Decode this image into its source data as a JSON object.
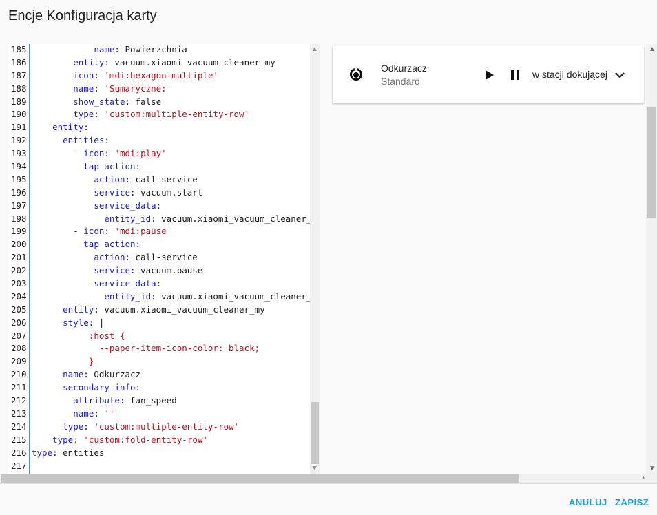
{
  "dialog": {
    "title": "Encje Konfiguracja karty",
    "cancel_label": "ANULUJ",
    "save_label": "ZAPISZ"
  },
  "editor": {
    "lines": [
      {
        "n": "185",
        "parts": [
          [
            "",
            "            "
          ],
          [
            "k",
            "name"
          ],
          [
            "v",
            ": Powierzchnia"
          ]
        ]
      },
      {
        "n": "186",
        "parts": [
          [
            "",
            "        "
          ],
          [
            "k",
            "entity"
          ],
          [
            "v",
            ": vacuum.xiaomi_vacuum_cleaner_my"
          ]
        ]
      },
      {
        "n": "187",
        "parts": [
          [
            "",
            "        "
          ],
          [
            "k",
            "icon"
          ],
          [
            "v",
            ": "
          ],
          [
            "s",
            "'mdi:hexagon-multiple'"
          ]
        ]
      },
      {
        "n": "188",
        "parts": [
          [
            "",
            "        "
          ],
          [
            "k",
            "name"
          ],
          [
            "v",
            ": "
          ],
          [
            "s",
            "'Sumaryczne:'"
          ]
        ]
      },
      {
        "n": "189",
        "parts": [
          [
            "",
            "        "
          ],
          [
            "k",
            "show_state"
          ],
          [
            "v",
            ": false"
          ]
        ]
      },
      {
        "n": "190",
        "parts": [
          [
            "",
            "        "
          ],
          [
            "k",
            "type"
          ],
          [
            "v",
            ": "
          ],
          [
            "s",
            "'custom:multiple-entity-row'"
          ]
        ]
      },
      {
        "n": "191",
        "parts": [
          [
            "",
            "    "
          ],
          [
            "k",
            "entity"
          ],
          [
            "v",
            ":"
          ]
        ]
      },
      {
        "n": "192",
        "parts": [
          [
            "",
            "      "
          ],
          [
            "k",
            "entities"
          ],
          [
            "v",
            ":"
          ]
        ]
      },
      {
        "n": "193",
        "parts": [
          [
            "",
            "        "
          ],
          [
            "v",
            "- "
          ],
          [
            "k",
            "icon"
          ],
          [
            "v",
            ": "
          ],
          [
            "s",
            "'mdi:play'"
          ]
        ]
      },
      {
        "n": "194",
        "parts": [
          [
            "",
            "          "
          ],
          [
            "k",
            "tap_action"
          ],
          [
            "v",
            ":"
          ]
        ]
      },
      {
        "n": "195",
        "parts": [
          [
            "",
            "            "
          ],
          [
            "k",
            "action"
          ],
          [
            "v",
            ": call-service"
          ]
        ]
      },
      {
        "n": "196",
        "parts": [
          [
            "",
            "            "
          ],
          [
            "k",
            "service"
          ],
          [
            "v",
            ": vacuum.start"
          ]
        ]
      },
      {
        "n": "197",
        "parts": [
          [
            "",
            "            "
          ],
          [
            "k",
            "service_data"
          ],
          [
            "v",
            ":"
          ]
        ]
      },
      {
        "n": "198",
        "parts": [
          [
            "",
            "              "
          ],
          [
            "k",
            "entity_id"
          ],
          [
            "v",
            ": vacuum.xiaomi_vacuum_cleaner_"
          ]
        ]
      },
      {
        "n": "199",
        "parts": [
          [
            "",
            "        "
          ],
          [
            "v",
            "- "
          ],
          [
            "k",
            "icon"
          ],
          [
            "v",
            ": "
          ],
          [
            "s",
            "'mdi:pause'"
          ]
        ]
      },
      {
        "n": "200",
        "parts": [
          [
            "",
            "          "
          ],
          [
            "k",
            "tap_action"
          ],
          [
            "v",
            ":"
          ]
        ]
      },
      {
        "n": "201",
        "parts": [
          [
            "",
            "            "
          ],
          [
            "k",
            "action"
          ],
          [
            "v",
            ": call-service"
          ]
        ]
      },
      {
        "n": "202",
        "parts": [
          [
            "",
            "            "
          ],
          [
            "k",
            "service"
          ],
          [
            "v",
            ": vacuum.pause"
          ]
        ]
      },
      {
        "n": "203",
        "parts": [
          [
            "",
            "            "
          ],
          [
            "k",
            "service_data"
          ],
          [
            "v",
            ":"
          ]
        ]
      },
      {
        "n": "204",
        "parts": [
          [
            "",
            "              "
          ],
          [
            "k",
            "entity_id"
          ],
          [
            "v",
            ": vacuum.xiaomi_vacuum_cleaner_"
          ]
        ]
      },
      {
        "n": "205",
        "parts": [
          [
            "",
            "      "
          ],
          [
            "k",
            "entity"
          ],
          [
            "v",
            ": vacuum.xiaomi_vacuum_cleaner_my"
          ]
        ]
      },
      {
        "n": "206",
        "parts": [
          [
            "",
            "      "
          ],
          [
            "k",
            "style"
          ],
          [
            "v",
            ": |"
          ]
        ]
      },
      {
        "n": "207",
        "parts": [
          [
            "",
            "           "
          ],
          [
            "s",
            ":host {"
          ]
        ]
      },
      {
        "n": "208",
        "parts": [
          [
            "",
            "             "
          ],
          [
            "s",
            "--paper-item-icon-color: black;"
          ]
        ]
      },
      {
        "n": "209",
        "parts": [
          [
            "",
            "           "
          ],
          [
            "s",
            "}"
          ]
        ]
      },
      {
        "n": "210",
        "parts": [
          [
            "",
            "      "
          ],
          [
            "k",
            "name"
          ],
          [
            "v",
            ": Odkurzacz"
          ]
        ]
      },
      {
        "n": "211",
        "parts": [
          [
            "",
            "      "
          ],
          [
            "k",
            "secondary_info"
          ],
          [
            "v",
            ":"
          ]
        ]
      },
      {
        "n": "212",
        "parts": [
          [
            "",
            "        "
          ],
          [
            "k",
            "attribute"
          ],
          [
            "v",
            ": fan_speed"
          ]
        ]
      },
      {
        "n": "213",
        "parts": [
          [
            "",
            "        "
          ],
          [
            "k",
            "name"
          ],
          [
            "v",
            ": "
          ],
          [
            "s",
            "''"
          ]
        ]
      },
      {
        "n": "214",
        "parts": [
          [
            "",
            "      "
          ],
          [
            "k",
            "type"
          ],
          [
            "v",
            ": "
          ],
          [
            "s",
            "'custom:multiple-entity-row'"
          ]
        ]
      },
      {
        "n": "215",
        "parts": [
          [
            "",
            "    "
          ],
          [
            "k",
            "type"
          ],
          [
            "v",
            ": "
          ],
          [
            "s",
            "'custom:fold-entity-row'"
          ]
        ]
      },
      {
        "n": "216",
        "parts": [
          [
            "k",
            "type"
          ],
          [
            "v",
            ": entities"
          ]
        ]
      },
      {
        "n": "217",
        "parts": []
      }
    ]
  },
  "preview": {
    "row_icon": "robot-vacuum-icon",
    "name": "Odkurzacz",
    "secondary": "Standard",
    "play_icon": "play-icon",
    "pause_icon": "pause-icon",
    "state": "w stacji dokującej",
    "expand_icon": "chevron-down-icon"
  }
}
